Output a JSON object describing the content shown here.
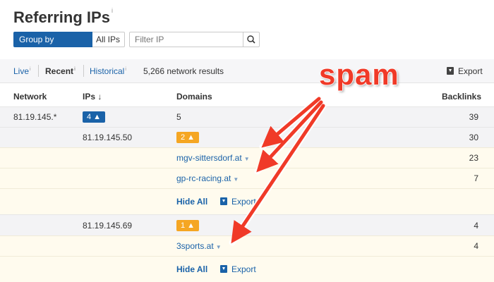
{
  "title": "Referring IPs",
  "title_info": "i",
  "group": {
    "active": "Group by networks",
    "inactive": "All IPs"
  },
  "filter": {
    "placeholder": "Filter IP"
  },
  "toolbar": {
    "live": "Live",
    "recent": "Recent",
    "historical": "Historical",
    "info": "i",
    "results": "5,266 network results",
    "export": "Export"
  },
  "columns": {
    "network": "Network",
    "ips": "IPs",
    "ips_sort": "↓",
    "domains": "Domains",
    "backlinks": "Backlinks"
  },
  "rows": {
    "network": {
      "name": "81.19.145.*",
      "ips": "4",
      "domains": "5",
      "backlinks": "39"
    },
    "ip1": {
      "ip": "81.19.145.50",
      "domains": "2",
      "backlinks": "30"
    },
    "d1": {
      "domain": "mgv-sittersdorf.at",
      "backlinks": "23"
    },
    "d2": {
      "domain": "gp-rc-racing.at",
      "backlinks": "7"
    },
    "actions1": {
      "hide": "Hide All",
      "export": "Export"
    },
    "ip2": {
      "ip": "81.19.145.69",
      "domains": "1",
      "backlinks": "4"
    },
    "d3": {
      "domain": "3sports.at",
      "backlinks": "4"
    },
    "actions2": {
      "hide": "Hide All",
      "export": "Export"
    }
  },
  "annotation": {
    "text": "spam",
    "color": "#f03a28"
  },
  "colors": {
    "accent": "#1a62a8",
    "badge_orange": "#f5a623",
    "annotation_red": "#f03a28"
  }
}
